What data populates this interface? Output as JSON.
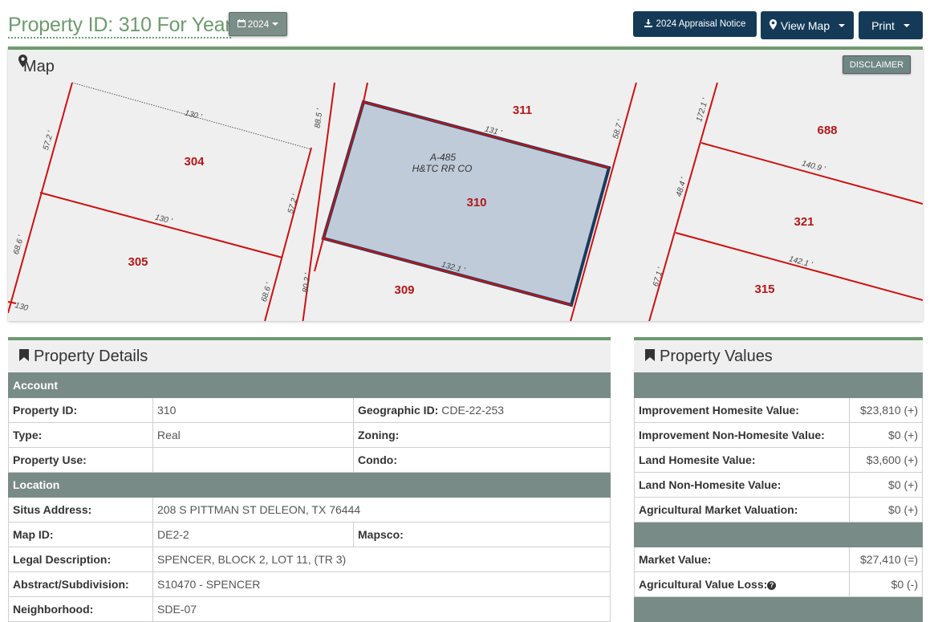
{
  "header": {
    "title": "Property ID: 310 For Year",
    "year_label": "2024",
    "appraisal_notice_label": "2024 Appraisal Notice",
    "view_map_label": "View Map",
    "print_label": "Print"
  },
  "map": {
    "heading": "Map",
    "disclaimer_label": "DISCLAIMER",
    "parcel_labels": [
      "304",
      "305",
      "309",
      "310",
      "311",
      "688",
      "321",
      "315"
    ],
    "subject_annotation": [
      "A-485",
      "H&TC RR CO"
    ],
    "dimension_labels": [
      "130 '",
      "130 '",
      "57.2 '",
      "68.6 '",
      "88.5 '",
      "57.2 '",
      "68.6 '",
      "80.2 '",
      "131 '",
      "58.7 '",
      "132.1 '",
      "172.1 '",
      "140.9 '",
      "48.4 '",
      "142.1 '",
      "67.1 '",
      "130"
    ],
    "colors": {
      "parcel_line": "#cc1111",
      "subject_fill": "#bfcbd9",
      "subject_border": "#1a3a5e",
      "label": "#b01818"
    }
  },
  "details": {
    "heading": "Property Details",
    "account_section": "Account",
    "location_section": "Location",
    "property_id_label": "Property ID:",
    "property_id_value": "310",
    "geographic_id_label": "Geographic ID:",
    "geographic_id_value": "CDE-22-253",
    "type_label": "Type:",
    "type_value": "Real",
    "zoning_label": "Zoning:",
    "property_use_label": "Property Use:",
    "condo_label": "Condo:",
    "situs_label": "Situs Address:",
    "situs_value": "208 S PITTMAN ST DELEON, TX 76444",
    "map_id_label": "Map ID:",
    "map_id_value": "DE2-2",
    "mapsco_label": "Mapsco:",
    "legal_label": "Legal Description:",
    "legal_value": "SPENCER, BLOCK 2, LOT 11, (TR 3)",
    "abstract_label": "Abstract/Subdivision:",
    "abstract_value": "S10470 - SPENCER",
    "neighborhood_label": "Neighborhood:",
    "neighborhood_value": "SDE-07"
  },
  "values": {
    "heading": "Property Values",
    "rows": [
      {
        "label": "Improvement Homesite Value:",
        "amount": "$23,810 (+)"
      },
      {
        "label": "Improvement Non-Homesite Value:",
        "amount": "$0 (+)"
      },
      {
        "label": "Land Homesite Value:",
        "amount": "$3,600 (+)"
      },
      {
        "label": "Land Non-Homesite Value:",
        "amount": "$0 (+)"
      },
      {
        "label": "Agricultural Market Valuation:",
        "amount": "$0 (+)"
      }
    ],
    "market_value_label": "Market Value:",
    "market_value_amount": "$27,410 (=)",
    "ag_loss_label": "Agricultural Value Loss:",
    "ag_loss_amount": "$0 (-)"
  }
}
